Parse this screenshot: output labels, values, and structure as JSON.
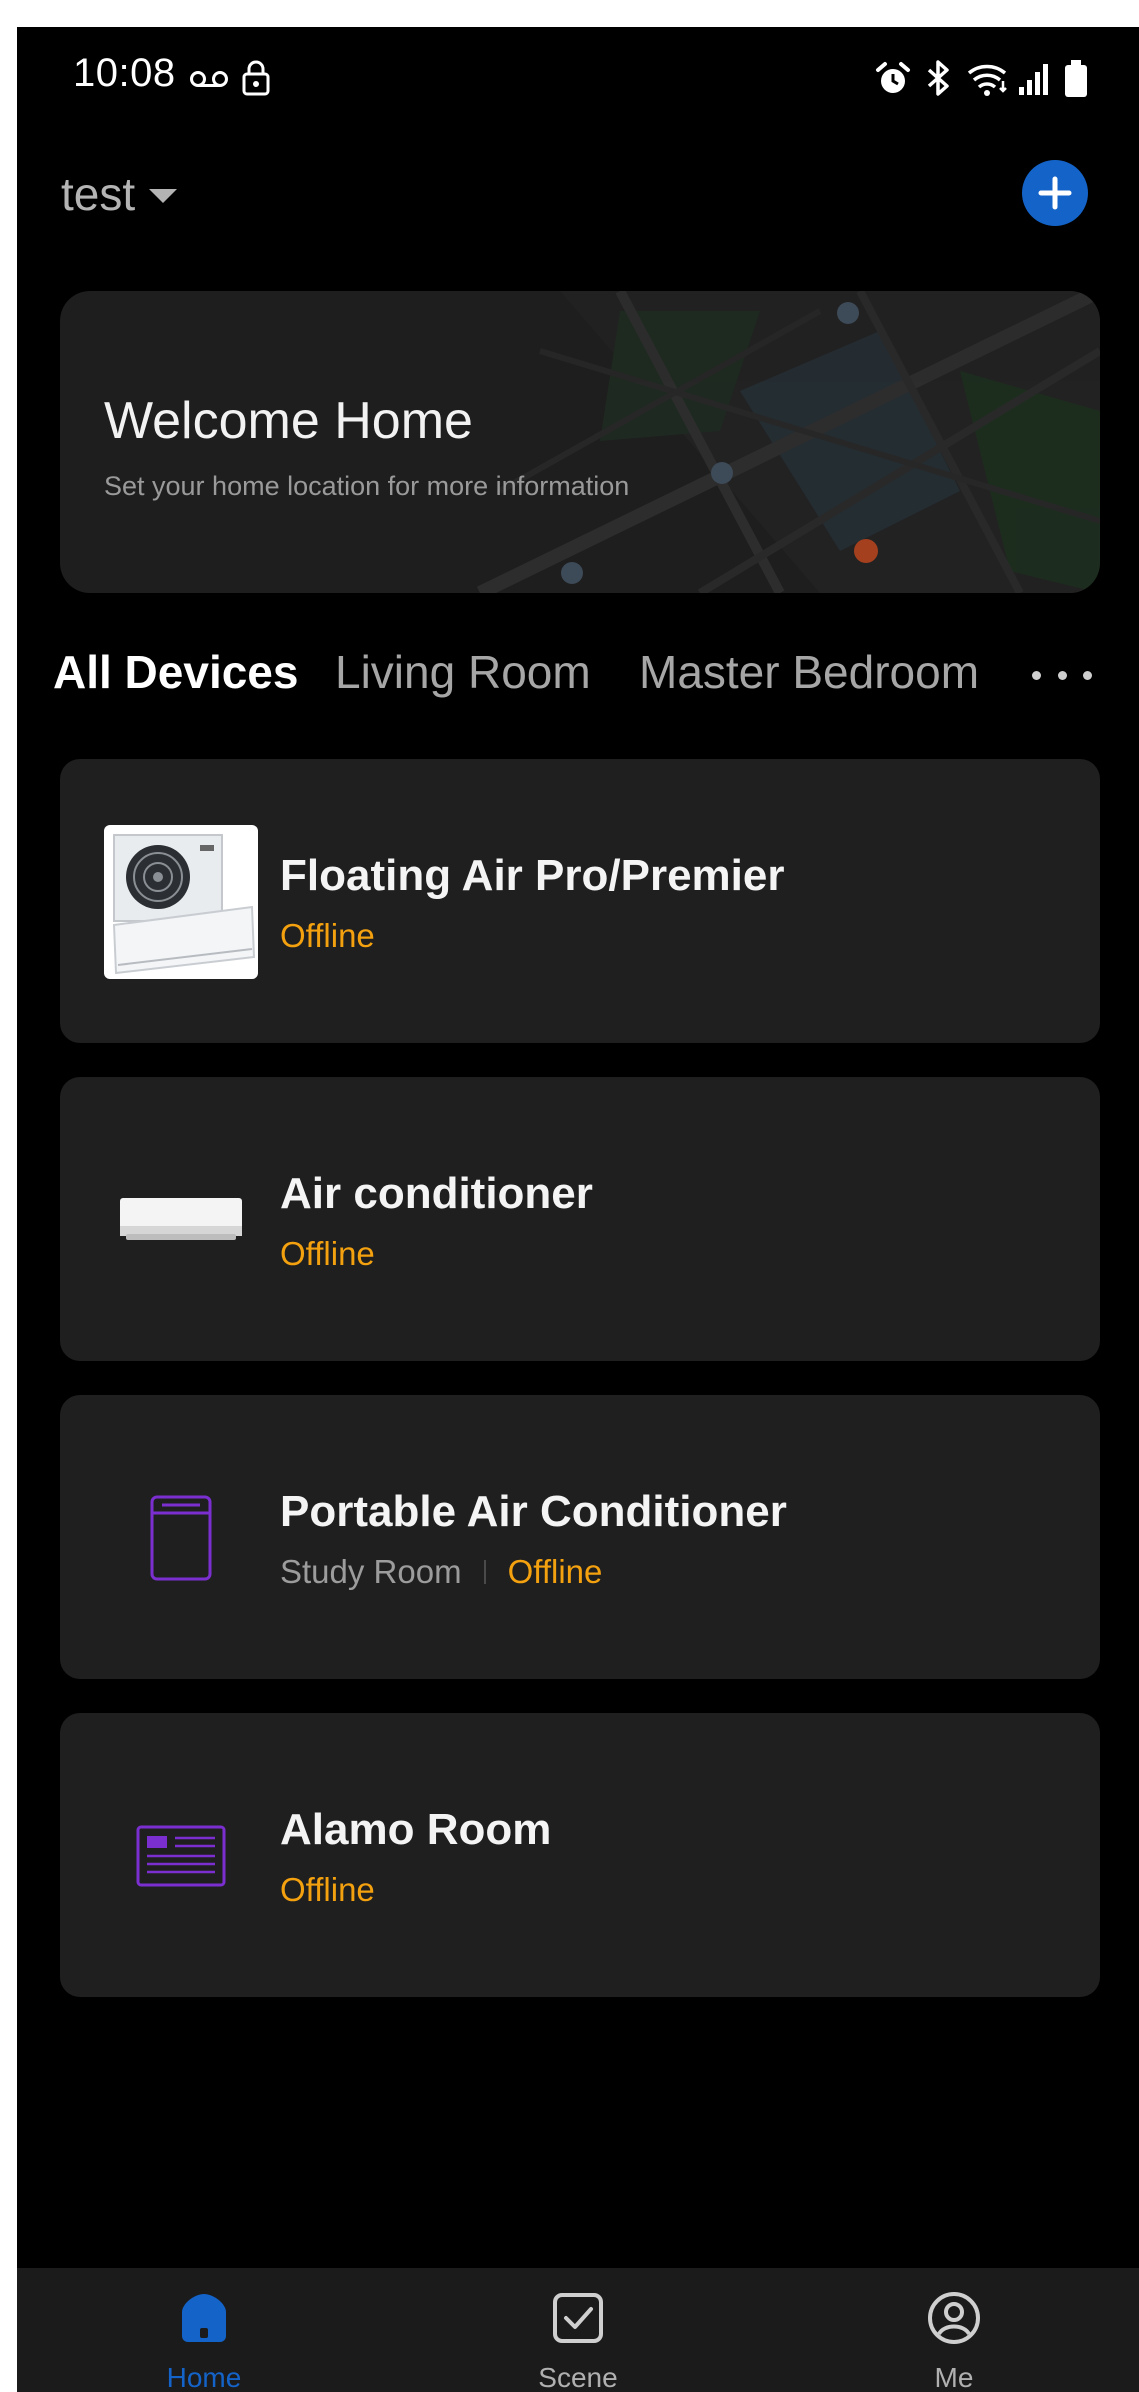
{
  "status_bar": {
    "time": "10:08",
    "left_icons": [
      "voicemail-icon",
      "lock-icon"
    ],
    "right_icons": [
      "alarm-icon",
      "bluetooth-icon",
      "wifi-icon",
      "signal-icon",
      "battery-icon"
    ]
  },
  "header": {
    "home_name": "test"
  },
  "welcome": {
    "title": "Welcome Home",
    "subtitle": "Set your home location for more information"
  },
  "rooms": {
    "tabs": [
      {
        "label": "All Devices",
        "active": true
      },
      {
        "label": "Living Room",
        "active": false
      },
      {
        "label": "Master Bedroom",
        "active": false
      }
    ]
  },
  "devices": [
    {
      "name": "Floating Air Pro/Premier",
      "room": "",
      "status": "Offline",
      "icon": "split-ac-product-image"
    },
    {
      "name": "Air conditioner",
      "room": "",
      "status": "Offline",
      "icon": "wall-ac-icon"
    },
    {
      "name": "Portable Air Conditioner",
      "room": "Study Room",
      "status": "Offline",
      "icon": "portable-ac-icon"
    },
    {
      "name": "Alamo Room",
      "room": "",
      "status": "Offline",
      "icon": "panel-unit-icon"
    }
  ],
  "bottom_nav": {
    "items": [
      {
        "label": "Home",
        "active": true
      },
      {
        "label": "Scene",
        "active": false
      },
      {
        "label": "Me",
        "active": false
      }
    ]
  },
  "colors": {
    "background": "#000000",
    "card": "#1f1f1f",
    "accent": "#1463c8",
    "status_offline": "#f4a10f",
    "device_icon_purple": "#7b2fd0"
  }
}
